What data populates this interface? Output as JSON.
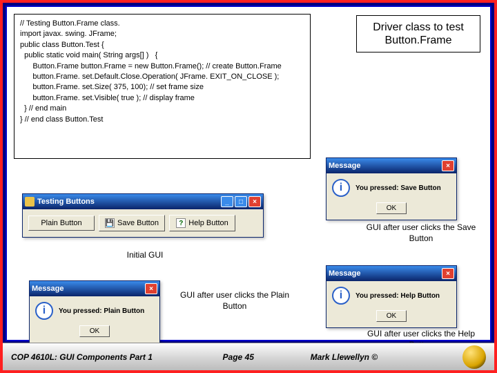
{
  "code": "// Testing Button.Frame class.\nimport javax. swing. JFrame;\npublic class Button.Test {\n  public static void main( String args[] )   {\n      Button.Frame button.Frame = new Button.Frame(); // create Button.Frame\n      button.Frame. set.Default.Close.Operation( JFrame. EXIT_ON_CLOSE );\n      button.Frame. set.Size( 375, 100); // set frame size\n      button.Frame. set.Visible( true ); // display frame\n  } // end main\n} // end class Button.Test",
  "driver_label": "Driver class to test Button.Frame",
  "captions": {
    "initial": "Initial GUI",
    "save": "GUI after user clicks the Save Button",
    "plain": "GUI after user clicks the Plain Button",
    "help": "GUI after user clicks the Help Button"
  },
  "main_window": {
    "title": "Testing Buttons",
    "buttons": {
      "plain": "Plain Button",
      "save": "Save Button",
      "help": "Help Button"
    },
    "min_glyph": "_",
    "max_glyph": "□",
    "close_glyph": "×"
  },
  "message": {
    "title": "Message",
    "info_glyph": "i",
    "save_text": "You pressed: Save Button",
    "plain_text": "You pressed: Plain Button",
    "help_text": "You pressed: Help Button",
    "ok": "OK",
    "close_glyph": "×"
  },
  "footer": {
    "left": "COP 4610L: GUI Components Part 1",
    "mid": "Page 45",
    "right": "Mark Llewellyn ©"
  },
  "icons": {
    "save_glyph": "💾",
    "help_glyph": "?"
  }
}
